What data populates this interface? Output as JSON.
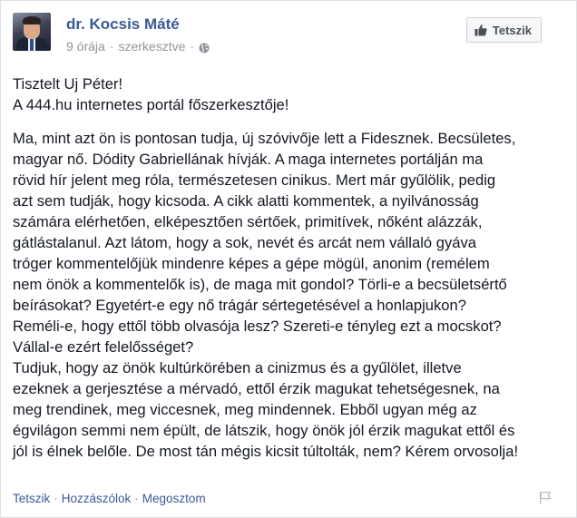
{
  "post": {
    "author": "dr. Kocsis Máté",
    "time": "9 órája",
    "edited": "szerkesztve",
    "separator": "·",
    "like_button": "Tetszik",
    "greeting_lines": [
      "Tisztelt Uj Péter!",
      "A 444.hu internetes portál főszerkesztője!"
    ],
    "paragraph1_lines": [
      "Ma, mint azt ön is pontosan tudja, új szóvivője lett a Fidesznek. Becsületes,",
      "magyar nő. Dódity Gabriellának hívják. A maga internetes portálján ma",
      "rövid hír jelent meg róla, természetesen cinikus. Mert már gyűlölik, pedig",
      "azt sem tudják, hogy kicsoda. A cikk alatti kommentek, a nyilvánosság",
      "számára elérhetően, elképesztően sértőek, primitívek, nőként alázzák,",
      "gátlástalanul. Azt látom, hogy a sok, nevét és arcát nem vállaló gyáva",
      "tróger kommentelőjük mindenre képes a gépe mögül, anonim (remélem",
      "nem önök a kommentelők is), de maga mit gondol? Törli-e a becsületsértő",
      "beírásokat? Egyetért-e egy nő trágár sértegetésével a honlapjukon?",
      "Reméli-e, hogy ettől több olvasója lesz? Szereti-e tényleg ezt a mocskot?",
      "Vállal-e ezért felelősséget?"
    ],
    "paragraph2_lines": [
      "Tudjuk, hogy az önök kultúrkörében a cinizmus és a gyűlölet, illetve",
      "ezeknek a gerjesztése a mérvadó, ettől érzik magukat tehetségesnek, na",
      "meg trendinek, meg viccesnek, meg mindennek. Ebből ugyan még az",
      "égvilágon semmi nem épült, de látszik, hogy önök jól érzik magukat ettől és",
      "jól is élnek belőle. De most tán mégis kicsit túltolták, nem? Kérem orvosolja!"
    ],
    "actions": {
      "like": "Tetszik",
      "comment": "Hozzászólok",
      "share": "Megosztom"
    },
    "colors": {
      "link_blue": "#3b5998",
      "meta_gray": "#90949c",
      "text": "#141823"
    },
    "icons": [
      "globe-icon",
      "thumbs-up-icon",
      "flag-icon"
    ]
  }
}
